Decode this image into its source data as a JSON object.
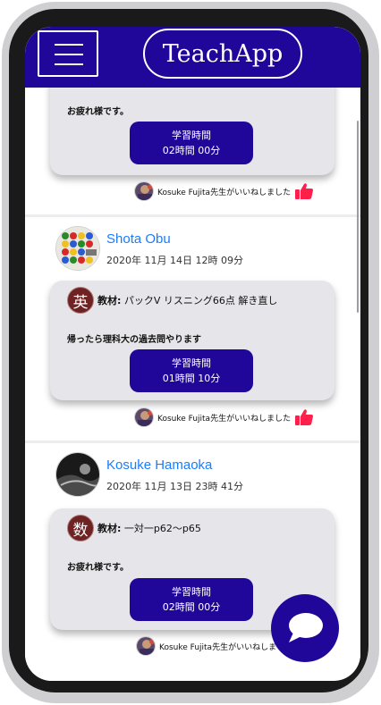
{
  "header": {
    "title": "TeachApp",
    "menu_icon": "hamburger-menu-icon"
  },
  "colors": {
    "brand": "#20079a",
    "link": "#1a7cff",
    "card": "#e6e6ea",
    "like": "#ff1f4b",
    "subject_badge": "#6e2222"
  },
  "posts": [
    {
      "comment": "お疲れ様です。",
      "study_label": "学習時間",
      "study_time": "02時間 00分",
      "like_text": "Kosuke Fujita先生がいいねしました"
    },
    {
      "user": "Shota Obu",
      "date": "2020年 11月 14日 12時 09分",
      "subject": "英",
      "material_label": "教材:",
      "material": "パックV リスニング66点 解き直し",
      "comment": "帰ったら理科大の過去問やります",
      "study_label": "学習時間",
      "study_time": "01時間 10分",
      "like_text": "Kosuke Fujita先生がいいねしました"
    },
    {
      "user": "Kosuke Hamaoka",
      "date": "2020年 11月 13日 23時 41分",
      "subject": "数",
      "material_label": "教材:",
      "material": "一対一p62〜p65",
      "comment": "お疲れ様です。",
      "study_label": "学習時間",
      "study_time": "02時間 00分",
      "like_text": "Kosuke Fujita先生がいいねしました"
    }
  ],
  "chat_icon": "chat-bubble-icon"
}
